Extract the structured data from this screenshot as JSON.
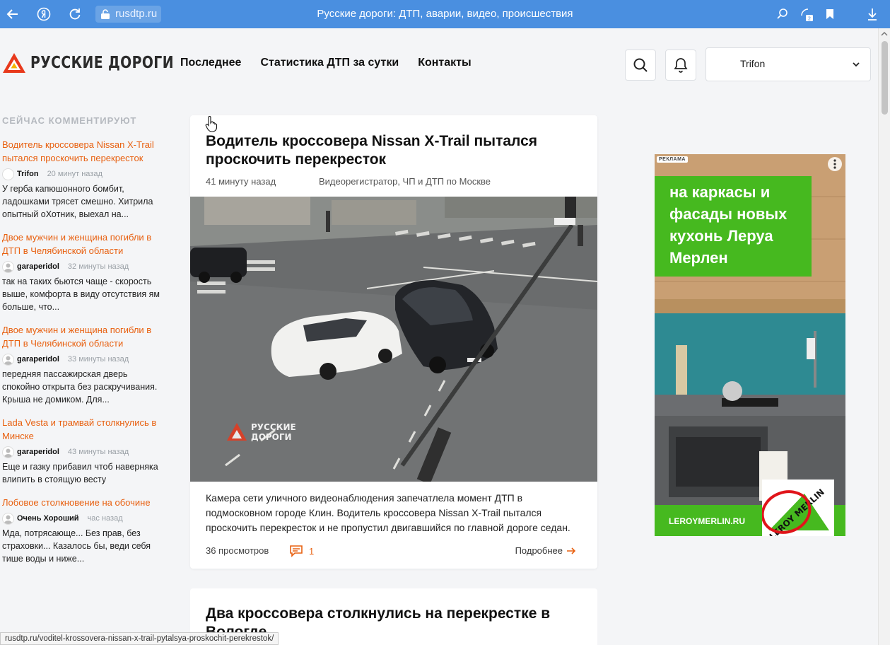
{
  "browser": {
    "url": "rusdtp.ru",
    "tab_title": "Русские дороги: ДТП, аварии, видео, происшествия",
    "tabs_count": "2",
    "status_url": "rusdtp.ru/voditel-krossovera-nissan-x-trail-pytalsya-proskochit-perekrestok/"
  },
  "header": {
    "logo_text": "РУССКИЕ ДОРОГИ",
    "nav": [
      "Последнее",
      "Статистика ДТП за сутки",
      "Контакты"
    ],
    "user_name": "Trifon"
  },
  "sidebar": {
    "heading": "СЕЙЧАС КОММЕНТИРУЮТ",
    "items": [
      {
        "title": "Водитель кроссовера Nissan X-Trail пытался проскочить перекресток",
        "user": "Trifon",
        "time": "20 минут назад",
        "text": "У герба капюшонного бомбит, ладошками трясет смешно. Хитрила опытный оХотник, выехал на..."
      },
      {
        "title": "Двое мужчин и женщина погибли в ДТП в Челябинской области",
        "user": "garaperidol",
        "time": "32 минуты назад",
        "text": "так на таких бьются чаще - скорость выше, комфорта в виду отсутствия ям больше, что..."
      },
      {
        "title": "Двое мужчин и женщина погибли в ДТП в Челябинской области",
        "user": "garaperidol",
        "time": "33 минуты назад",
        "text": "передняя пассажирская дверь спокойно открыта без раскручивания. Крыша не домиком. Для..."
      },
      {
        "title": "Lada Vesta и трамвай столкнулись в Минске",
        "user": "garaperidol",
        "time": "43 минуты назад",
        "text": "Еще и газку прибавил чтоб наверняка влипить в стоящую весту"
      },
      {
        "title": "Лобовое столкновение на обочине",
        "user": "Очень Хороший",
        "time": "час назад",
        "text": "Мда, потрясающе... Без прав, без страховки... Казалось бы, веди себя тише воды и ниже..."
      }
    ]
  },
  "article": {
    "title": "Водитель кроссовера Nissan X-Trail пытался проскочить перекресток",
    "time": "41 минуту назад",
    "category": "Видеорегистратор, ЧП и ДТП по Москве",
    "image_watermark": "РУССКИЕ ДОРОГИ",
    "description": "Камера сети уличного видеонаблюдения запечатлела момент ДТП в подмосковном городе Клин. Водитель кроссовера Nissan X-Trail пытался проскочить перекресток и не пропустил двигавшийся по главной дороге седан.",
    "views": "36 просмотров",
    "comments": "1",
    "more": "Подробнее"
  },
  "article2": {
    "title": "Два кроссовера столкнулись на перекрестке в Вологде"
  },
  "ad": {
    "label": "РЕКЛАМА",
    "headline": "на каркасы и фасады новых кухонь Леруа Мерлен",
    "url": "LEROYMERLIN.RU",
    "brand": "LEROY MERLIN"
  },
  "colors": {
    "accent": "#e86010",
    "browser_bar": "#4a8fe0",
    "ad_green": "#46b91f"
  }
}
